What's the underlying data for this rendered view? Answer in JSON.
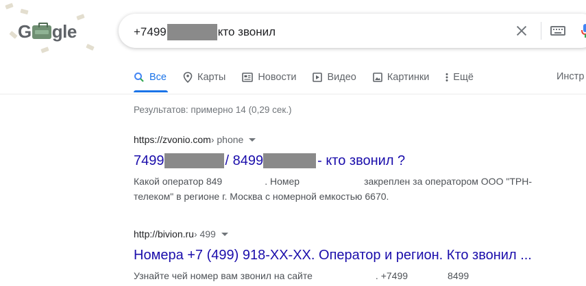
{
  "logo": {
    "text_left": "G",
    "text_right": "gle"
  },
  "search": {
    "query_prefix": "+7499",
    "query_suffix": "кто звонил"
  },
  "tabs": [
    {
      "label": "Все",
      "icon": "search-icon"
    },
    {
      "label": "Карты",
      "icon": "map-pin-icon"
    },
    {
      "label": "Новости",
      "icon": "news-icon"
    },
    {
      "label": "Видео",
      "icon": "video-icon"
    },
    {
      "label": "Картинки",
      "icon": "image-icon"
    },
    {
      "label": "Ещё",
      "icon": "more-vert-icon"
    }
  ],
  "tools_label": "Инстр",
  "stats": "Результатов: примерно 14 (0,29 сек.)",
  "results": [
    {
      "url": "https://zvonio.com",
      "path": " › phone",
      "title_a": "7499",
      "title_b": "/ 8499",
      "title_c": "- кто звонил ?",
      "snippet_a": "Какой оператор 849",
      "snippet_b": ". Номер",
      "snippet_c": "закреплен за оператором ООО \"ТРН-",
      "snippet_d": "телеком\" в регионе г. Москва с номерной емкостью 6670."
    },
    {
      "url": "http://bivion.ru",
      "path": " › 499",
      "title": "Номера +7 (499) 918-XX-XX. Оператор и регион. Кто звонил ...",
      "snippet_a": "Узнайте чей номер вам звонил на сайте",
      "snippet_b": ". +7499",
      "snippet_c": "8499"
    }
  ],
  "colors": {
    "link": "#1a0dab",
    "active_tab": "#1a73e8",
    "snippet": "#4d5156",
    "redaction": "#8a8a8a"
  }
}
